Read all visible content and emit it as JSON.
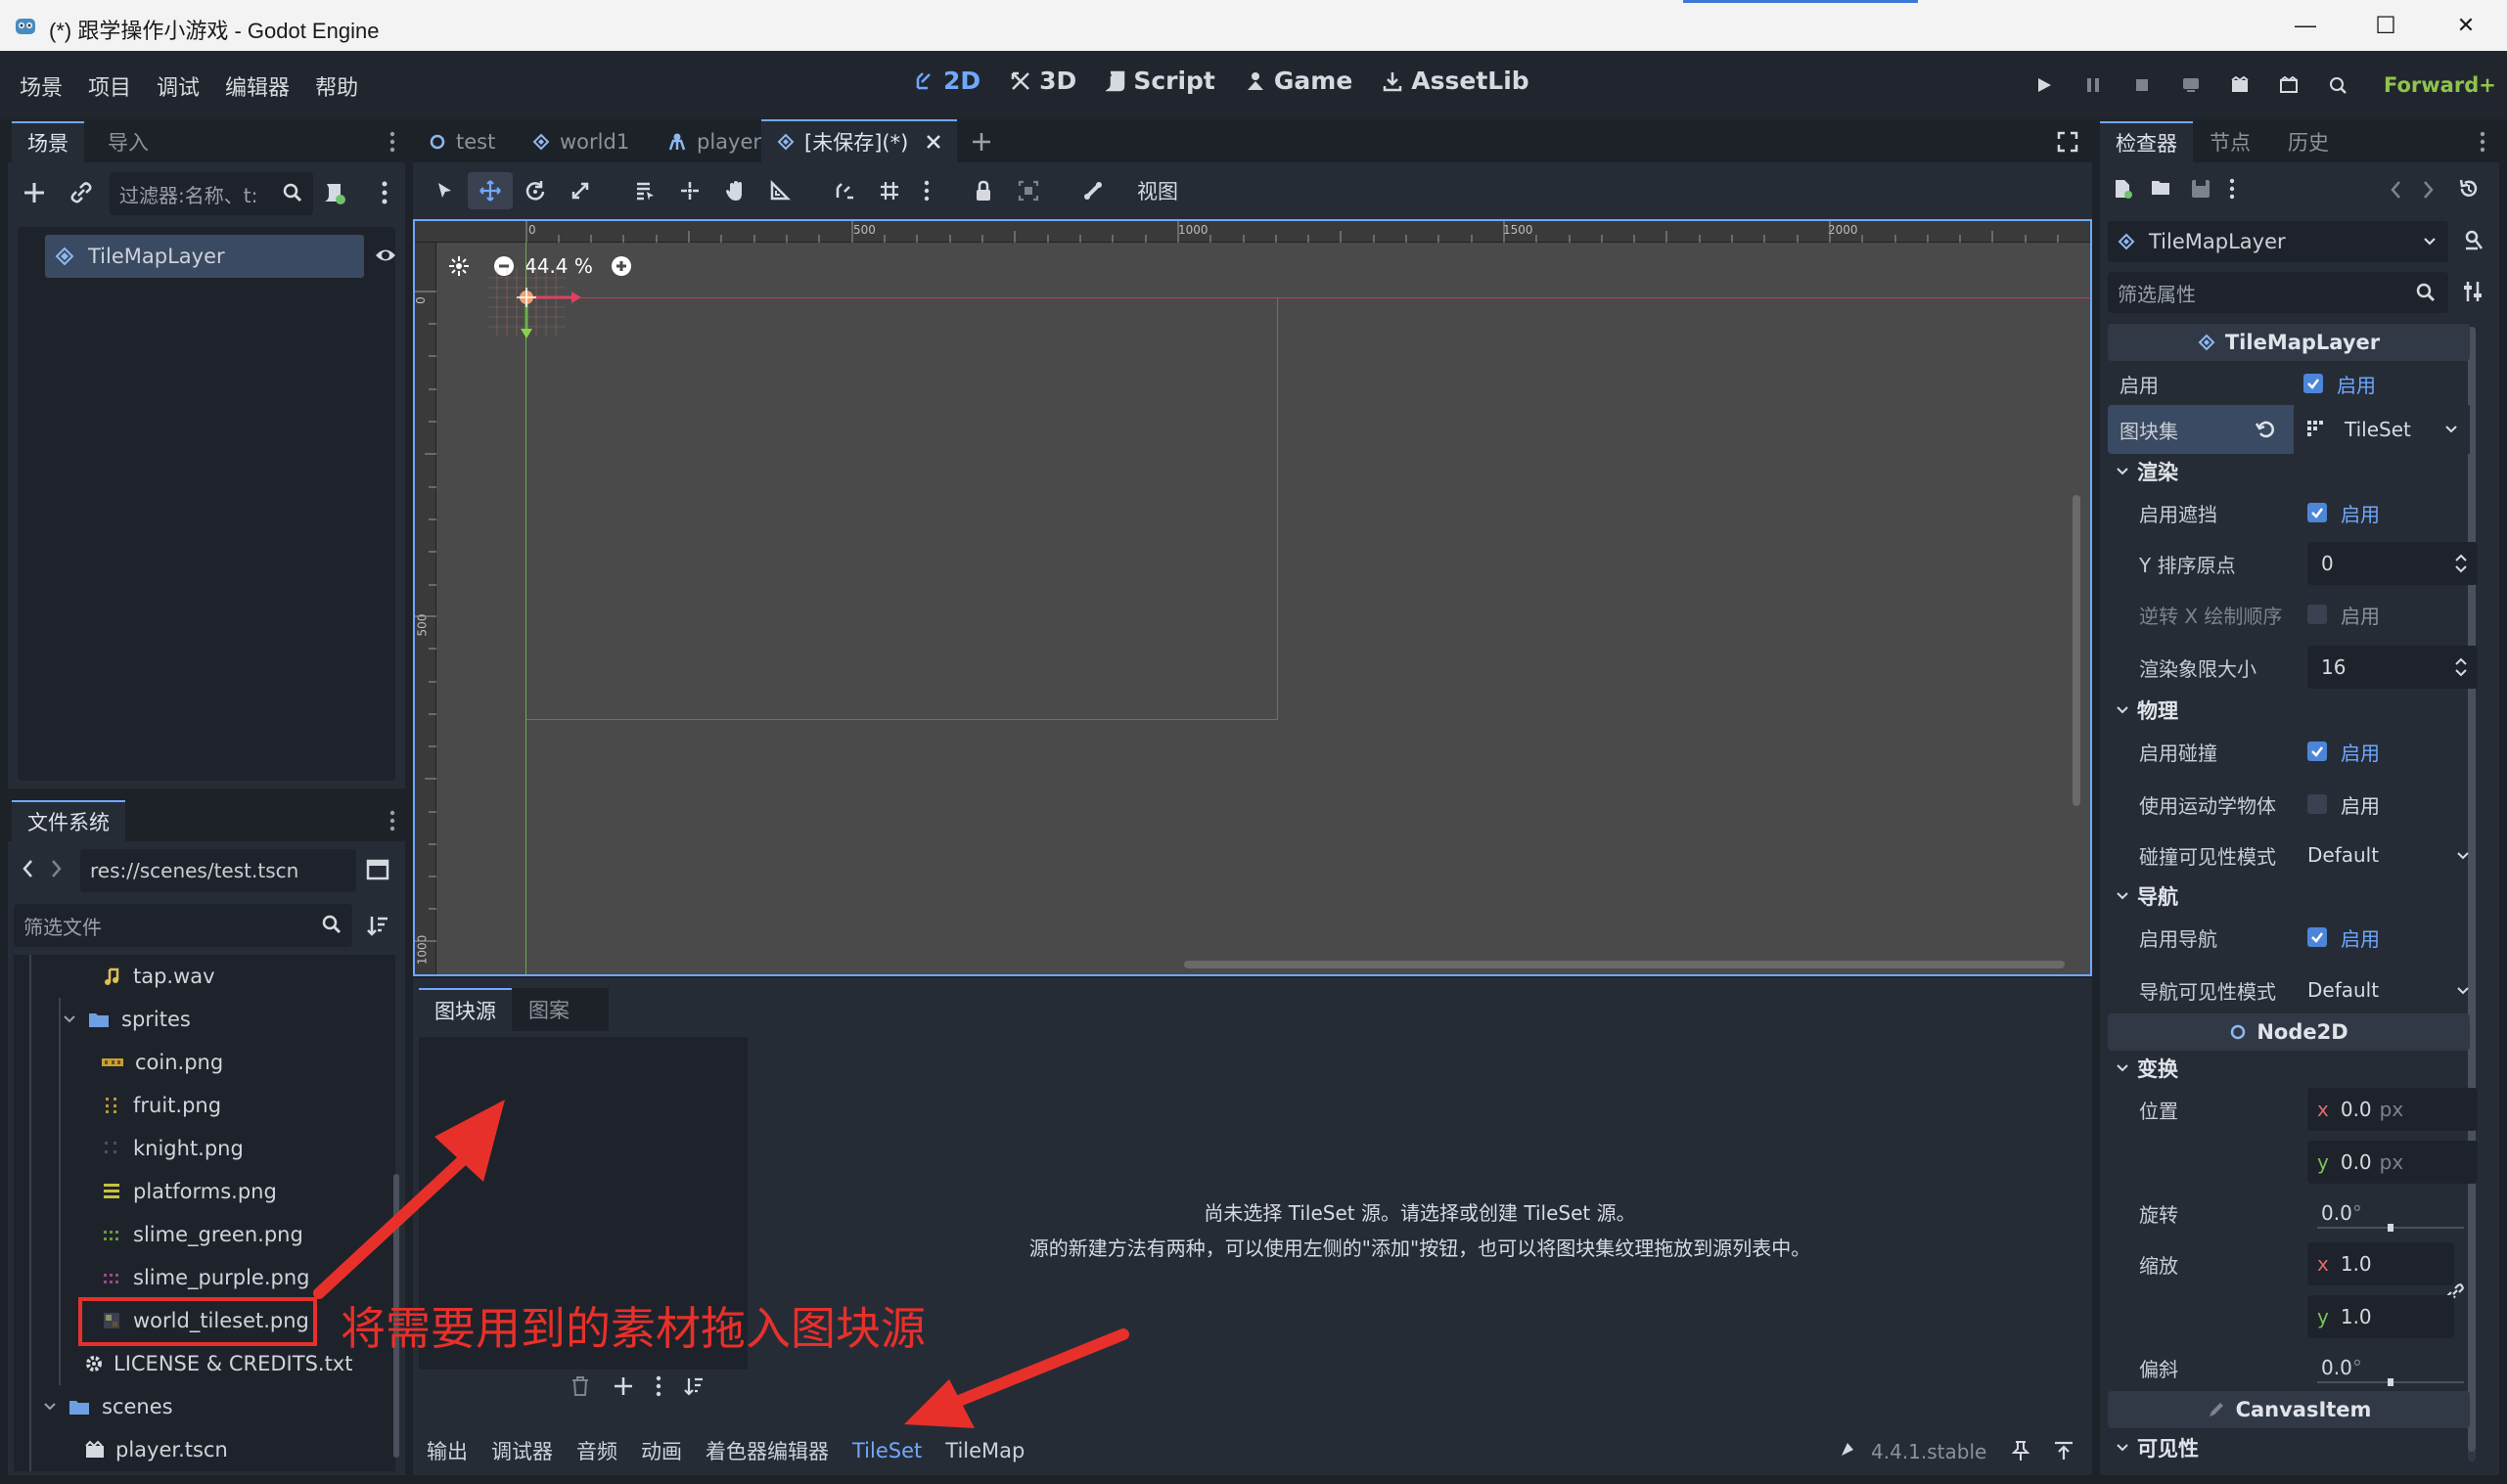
{
  "window": {
    "title": "(*) 跟学操作小游戏 - Godot Engine",
    "controls": {
      "minimize": "—",
      "maximize": "☐",
      "close": "✕"
    }
  },
  "menu": {
    "items": [
      "场景",
      "项目",
      "调试",
      "编辑器",
      "帮助"
    ],
    "modes": [
      "2D",
      "3D",
      "Script",
      "Game",
      "AssetLib"
    ],
    "renderer": "Forward+"
  },
  "scene_dock": {
    "tabs": [
      "场景",
      "导入"
    ],
    "filter_placeholder": "过滤器:名称、t:",
    "root_node": "TileMapLayer"
  },
  "filesystem": {
    "tab": "文件系统",
    "path": "res://scenes/test.tscn",
    "filter_placeholder": "筛选文件",
    "items": [
      {
        "label": "tap.wav",
        "type": "audio"
      },
      {
        "label": "sprites",
        "type": "folder"
      },
      {
        "label": "coin.png",
        "type": "image"
      },
      {
        "label": "fruit.png",
        "type": "image"
      },
      {
        "label": "knight.png",
        "type": "image"
      },
      {
        "label": "platforms.png",
        "type": "image"
      },
      {
        "label": "slime_green.png",
        "type": "image"
      },
      {
        "label": "slime_purple.png",
        "type": "image"
      },
      {
        "label": "world_tileset.png",
        "type": "image"
      },
      {
        "label": "LICENSE & CREDITS.txt",
        "type": "text"
      },
      {
        "label": "scenes",
        "type": "folder"
      },
      {
        "label": "player.tscn",
        "type": "scene"
      }
    ]
  },
  "editor_tabs": [
    "test",
    "world1",
    "player",
    "[未保存](*)"
  ],
  "toolbar": {
    "view_label": "视图"
  },
  "viewport": {
    "zoom": "44.4 %",
    "ruler_h": [
      "0",
      "500",
      "1000",
      "1500",
      "2000"
    ],
    "ruler_v": [
      "0",
      "500",
      "1000"
    ]
  },
  "tileset_panel": {
    "tabs": [
      "图块源",
      "图案"
    ],
    "message_line1": "尚未选择 TileSet 源。请选择或创建 TileSet 源。",
    "message_line2": "源的新建方法有两种，可以使用左侧的\"添加\"按钮，也可以将图块集纹理拖放到源列表中。"
  },
  "bottom_bar": {
    "tabs": [
      "输出",
      "调试器",
      "音频",
      "动画",
      "着色器编辑器",
      "TileSet",
      "TileMap"
    ],
    "active": "TileSet",
    "version": "4.4.1.stable"
  },
  "annotation": {
    "text": "将需要用到的素材拖入图块源",
    "color": "#e8302a"
  },
  "inspector": {
    "tabs": [
      "检查器",
      "节点",
      "历史"
    ],
    "node_name": "TileMapLayer",
    "filter_placeholder": "筛选属性",
    "class_header": "TileMapLayer",
    "enabled_label": "启用",
    "enabled_text": "启用",
    "tileset_label": "图块集",
    "tileset_value": "TileSet",
    "rendering": {
      "title": "渲染",
      "occlusion_label": "启用遮挡",
      "occlusion_text": "启用",
      "y_sort_label": "Y 排序原点",
      "y_sort_value": "0",
      "x_draw_label": "逆转 X 绘制顺序",
      "x_draw_text": "启用",
      "quadrant_label": "渲染象限大小",
      "quadrant_value": "16"
    },
    "physics": {
      "title": "物理",
      "collision_label": "启用碰撞",
      "collision_text": "启用",
      "kinematic_label": "使用运动学物体",
      "kinematic_text": "启用",
      "vis_label": "碰撞可见性模式",
      "vis_value": "Default"
    },
    "navigation": {
      "title": "导航",
      "enabled_label": "启用导航",
      "enabled_text": "启用",
      "vis_label": "导航可见性模式",
      "vis_value": "Default"
    },
    "node2d_header": "Node2D",
    "transform": {
      "title": "变换",
      "position_label": "位置",
      "x_label": "x",
      "y_label": "y",
      "pos_x": "0.0",
      "pos_y": "0.0",
      "unit": "px",
      "rotation_label": "旋转",
      "rotation_value": "0.0",
      "degree": "°",
      "scale_label": "缩放",
      "scale_x": "1.0",
      "scale_y": "1.0",
      "skew_label": "偏斜",
      "skew_value": "0.0"
    },
    "canvasitem_header": "CanvasItem",
    "visibility_title": "可见性"
  }
}
